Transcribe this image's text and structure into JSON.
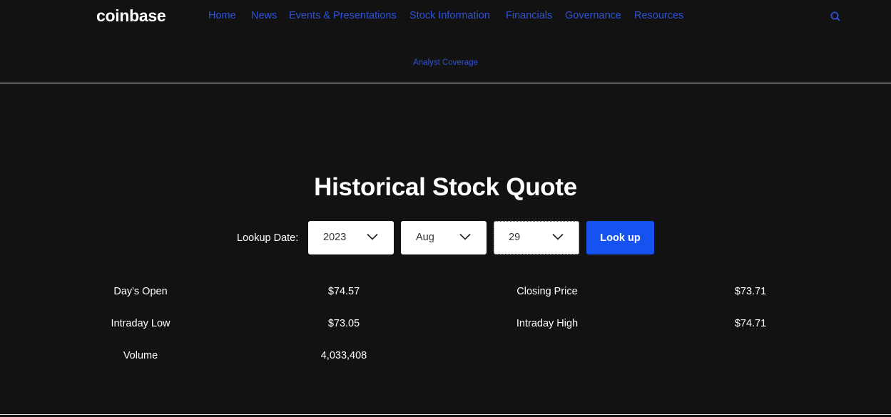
{
  "header": {
    "logo": "coinbase",
    "nav": [
      {
        "label": "Home"
      },
      {
        "label": "News"
      },
      {
        "label": "Events & Presentations"
      },
      {
        "label": "Stock Information"
      },
      {
        "label": "Financials"
      },
      {
        "label": "Governance"
      },
      {
        "label": "Resources"
      }
    ],
    "search_icon": "search-icon"
  },
  "subnav": {
    "items": [
      {
        "label": "Analyst Coverage"
      }
    ]
  },
  "main": {
    "title": "Historical Stock Quote",
    "lookup_label": "Lookup Date:",
    "year": "2023",
    "month": "Aug",
    "day": "29",
    "lookup_button": "Look up"
  },
  "stats": {
    "open_label": "Day's Open",
    "open_value": "$74.57",
    "close_label": "Closing Price",
    "close_value": "$73.71",
    "low_label": "Intraday Low",
    "low_value": "$73.05",
    "high_label": "Intraday High",
    "high_value": "$74.71",
    "volume_label": "Volume",
    "volume_value": "4,033,408"
  },
  "colors": {
    "background": "#121212",
    "link": "#2f52d6",
    "button": "#1652f0"
  }
}
